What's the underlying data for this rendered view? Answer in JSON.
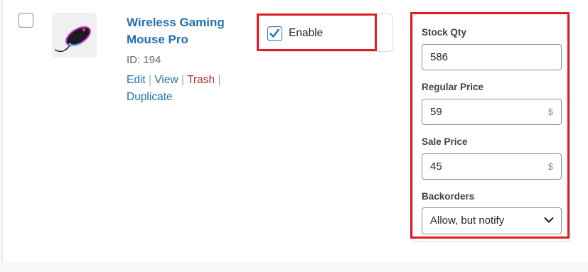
{
  "product": {
    "title": "Wireless Gaming Mouse Pro",
    "id_text": "ID: 194",
    "thumbnail_icon": "gaming-mouse-image"
  },
  "row_actions": {
    "edit": "Edit",
    "view": "View",
    "trash": "Trash",
    "duplicate": "Duplicate",
    "separator": "|"
  },
  "enable": {
    "label": "Enable",
    "checked": true
  },
  "inventory": {
    "stock_qty": {
      "label": "Stock Qty",
      "value": "586"
    },
    "regular_price": {
      "label": "Regular Price",
      "value": "59",
      "suffix": "$"
    },
    "sale_price": {
      "label": "Sale Price",
      "value": "45",
      "suffix": "$"
    },
    "backorders": {
      "label": "Backorders",
      "value": "Allow, but notify"
    }
  },
  "colors": {
    "link": "#2271b1",
    "trash": "#b32d2e",
    "highlight": "#e31c24"
  }
}
